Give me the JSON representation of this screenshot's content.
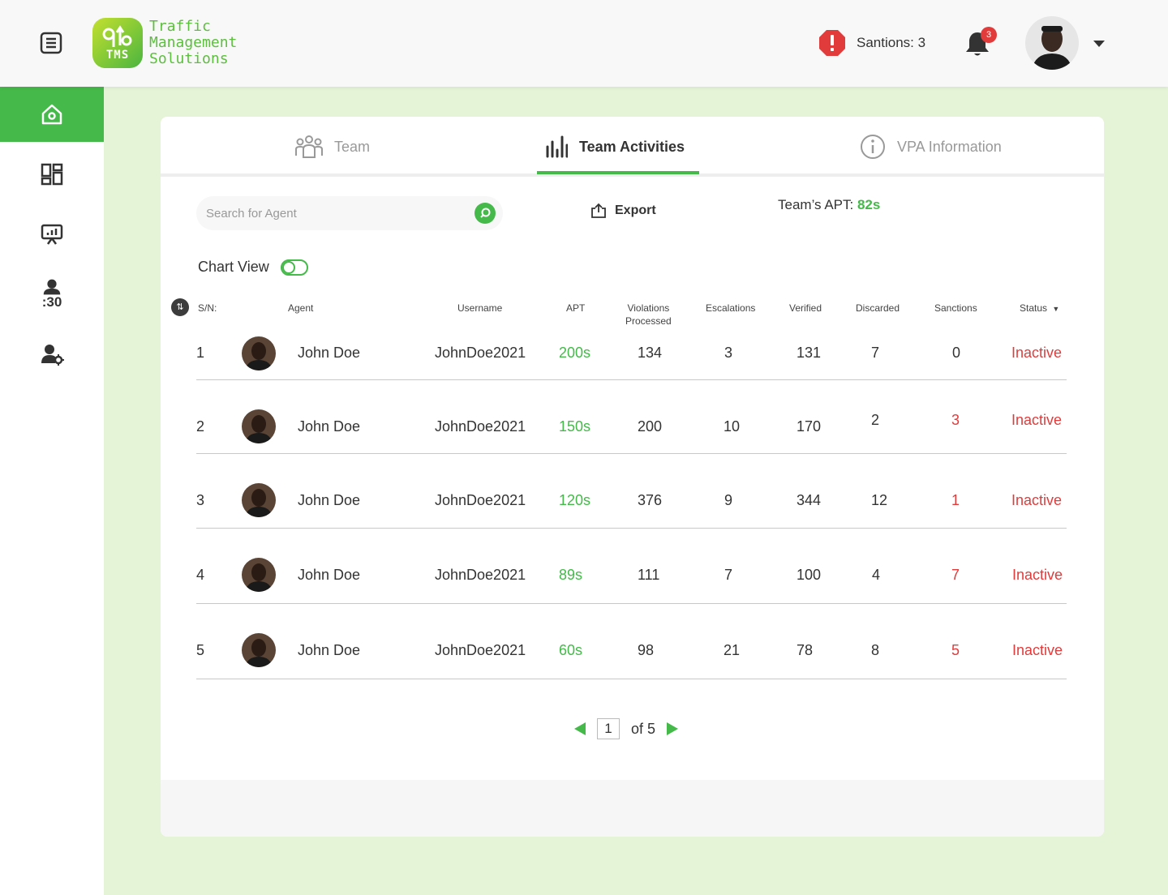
{
  "header": {
    "logo_short": "TMS",
    "logo_lines": [
      "Traffic",
      "Management",
      "Solutions"
    ],
    "sanctions_label": "Santions: 3",
    "notification_count": "3"
  },
  "sidebar": {
    "items": [
      {
        "icon": "home-icon",
        "active": true
      },
      {
        "icon": "dashboard-icon",
        "active": false
      },
      {
        "icon": "presentation-icon",
        "active": false
      },
      {
        "icon": "user-timer-icon",
        "label": ":30",
        "active": false
      },
      {
        "icon": "user-settings-icon",
        "active": false
      }
    ]
  },
  "tabs": [
    {
      "label": "Team",
      "icon": "team-icon",
      "active": false
    },
    {
      "label": "Team Activities",
      "icon": "bar-chart-icon",
      "active": true
    },
    {
      "label": "VPA Information",
      "icon": "info-icon",
      "active": false
    }
  ],
  "search": {
    "placeholder": "Search for Agent"
  },
  "export_label": "Export",
  "team_apt": {
    "label": "Team’s APT:",
    "value": "82s"
  },
  "chart_view_label": "Chart View",
  "table": {
    "sort_icon": "⇅",
    "headers": {
      "sn": "S/N:",
      "agent": "Agent",
      "username": "Username",
      "apt": "APT",
      "violations_1": "Violations",
      "violations_2": "Processed",
      "escalations": "Escalations",
      "verified": "Verified",
      "discarded": "Discarded",
      "sanctions": "Sanctions",
      "status": "Status"
    },
    "rows": [
      {
        "sn": "1",
        "agent": "John Doe",
        "username": "JohnDoe2021",
        "apt": "200s",
        "violations": "134",
        "escalations": "3",
        "verified": "131",
        "discarded": "7",
        "sanctions": "0",
        "status": "Inactive"
      },
      {
        "sn": "2",
        "agent": "John Doe",
        "username": "JohnDoe2021",
        "apt": "150s",
        "violations": "200",
        "escalations": "10",
        "verified": "170",
        "discarded": "2",
        "sanctions": "3",
        "status": "Inactive"
      },
      {
        "sn": "3",
        "agent": "John Doe",
        "username": "JohnDoe2021",
        "apt": "120s",
        "violations": "376",
        "escalations": "9",
        "verified": "344",
        "discarded": "12",
        "sanctions": "1",
        "status": "Inactive"
      },
      {
        "sn": "4",
        "agent": "John Doe",
        "username": "JohnDoe2021",
        "apt": "89s",
        "violations": "111",
        "escalations": "7",
        "verified": "100",
        "discarded": "4",
        "sanctions": "7",
        "status": "Inactive"
      },
      {
        "sn": "5",
        "agent": "John Doe",
        "username": "JohnDoe2021",
        "apt": "60s",
        "violations": "98",
        "escalations": "21",
        "verified": "78",
        "discarded": "8",
        "sanctions": "5",
        "status": "Inactive"
      }
    ]
  },
  "pagination": {
    "current": "1",
    "of_label": "of 5"
  },
  "colors": {
    "brand_green": "#45b94a",
    "danger_red": "#e23b3b",
    "page_bg": "#e5f3d7"
  }
}
